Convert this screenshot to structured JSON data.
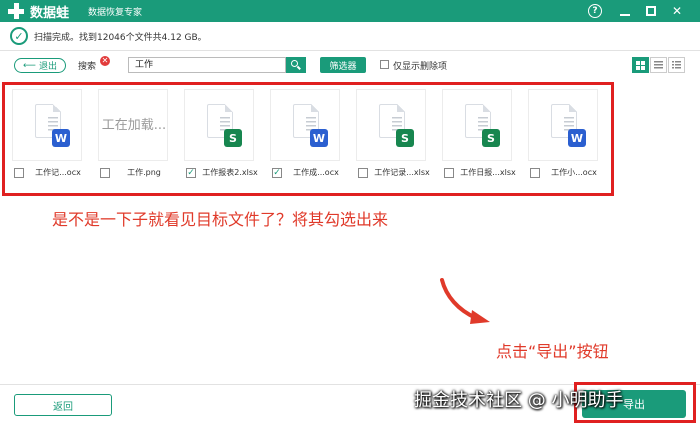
{
  "app": {
    "name": "数据蛙",
    "subtitle": "数据恢复专家",
    "help_icon": "help-icon",
    "help_glyph": "?",
    "min_icon": "minimize-icon",
    "max_icon": "maximize-icon",
    "close_icon": "close-icon",
    "close_glyph": "✕"
  },
  "status": {
    "icon": "check-circle-icon",
    "check_glyph": "✓",
    "text": "扫描完成。找到12046个文件共4.12 GB。"
  },
  "toolbar": {
    "back_label": "退出",
    "back_arrow": "⟵",
    "search_label": "搜索",
    "clear_glyph": "✕",
    "search_value": "工作",
    "filter_label": "筛选器",
    "show_deleted_label": "仅显示删除项",
    "show_deleted_checked": false,
    "view_mode": "grid"
  },
  "files": [
    {
      "type": "word",
      "badge": "W",
      "name": "工作记...ocx",
      "checked": false
    },
    {
      "type": "image",
      "loading_text": "工在加载...",
      "name": "工作.png",
      "checked": false
    },
    {
      "type": "excel",
      "badge": "S",
      "name": "工作报表2.xlsx",
      "checked": true
    },
    {
      "type": "word",
      "badge": "W",
      "name": "工作成...ocx",
      "checked": true
    },
    {
      "type": "excel",
      "badge": "S",
      "name": "工作记录...xlsx",
      "checked": false
    },
    {
      "type": "excel",
      "badge": "S",
      "name": "工作日报...xlsx",
      "checked": false
    },
    {
      "type": "word",
      "badge": "W",
      "name": "工作小...ocx",
      "checked": false
    }
  ],
  "annotations": {
    "tip1": "是不是一下子就看见目标文件了？将其勾选出来",
    "tip2": "点击“导出”按钮"
  },
  "footer": {
    "back_label": "返回",
    "export_label": "导出"
  },
  "watermark": "掘金技术社区 @ 小明助手",
  "colors": {
    "accent": "#1a9b7a",
    "highlight": "#e02020",
    "annotation": "#e03a2a",
    "word": "#2b5fd0",
    "excel": "#17864f"
  }
}
